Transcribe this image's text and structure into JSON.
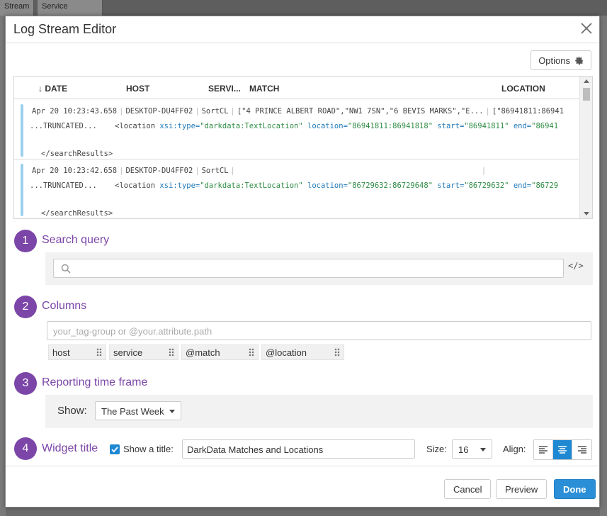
{
  "background": {
    "tabs": [
      "Stream",
      "Service Summary"
    ]
  },
  "modal": {
    "title": "Log Stream Editor",
    "options_label": "Options"
  },
  "log_table": {
    "columns": [
      "DATE",
      "HOST",
      "SERVI...",
      "MATCH",
      "LOCATION"
    ],
    "rows": [
      {
        "date": "Apr 20 10:23:43.658",
        "host": "DESKTOP-DU4FF02",
        "service": "SortCL",
        "match": "[\"4 PRINCE ALBERT ROAD\",\"NW1 7SN\",\"6 BEVIS MARKS\",\"E...",
        "location": "[\"86941811:86941",
        "truncated": "...TRUNCATED...",
        "xml_tag": "<location",
        "xml_type_attr": "xsi:type=",
        "xml_type_val": "\"darkdata:TextLocation\"",
        "xml_loc_attr": "location=",
        "xml_loc_val": "\"86941811:86941818\"",
        "xml_start_attr": "start=",
        "xml_start_val": "\"86941811\"",
        "xml_end_attr": "end=",
        "xml_end_val": "\"86941",
        "closing": "</searchResults>"
      },
      {
        "date": "Apr 20 10:23:42.658",
        "host": "DESKTOP-DU4FF02",
        "service": "SortCL",
        "match": "",
        "location": "",
        "truncated": "...TRUNCATED...",
        "xml_tag": "<location",
        "xml_type_attr": "xsi:type=",
        "xml_type_val": "\"darkdata:TextLocation\"",
        "xml_loc_attr": "location=",
        "xml_loc_val": "\"86729632:86729648\"",
        "xml_start_attr": "start=",
        "xml_start_val": "\"86729632\"",
        "xml_end_attr": "end=",
        "xml_end_val": "\"86729",
        "closing": "</searchResults>"
      }
    ]
  },
  "steps": {
    "search": {
      "number": "1",
      "title": "Search query",
      "placeholder": ""
    },
    "columns": {
      "number": "2",
      "title": "Columns",
      "placeholder": "your_tag-group or @your.attribute.path",
      "tags": [
        "host",
        "service",
        "@match",
        "@location"
      ]
    },
    "timeframe": {
      "number": "3",
      "title": "Reporting time frame",
      "show_label": "Show:",
      "value": "The Past Week"
    },
    "widget": {
      "number": "4",
      "title": "Widget title",
      "show_title_label": "Show a title:",
      "show_title_checked": true,
      "title_value": "DarkData Matches and Locations",
      "size_label": "Size:",
      "size_value": "16",
      "align_label": "Align:",
      "align_selected": "center"
    }
  },
  "footer": {
    "cancel": "Cancel",
    "preview": "Preview",
    "done": "Done"
  },
  "colors": {
    "accent": "#7c45a8",
    "primary": "#2a8fd6"
  }
}
